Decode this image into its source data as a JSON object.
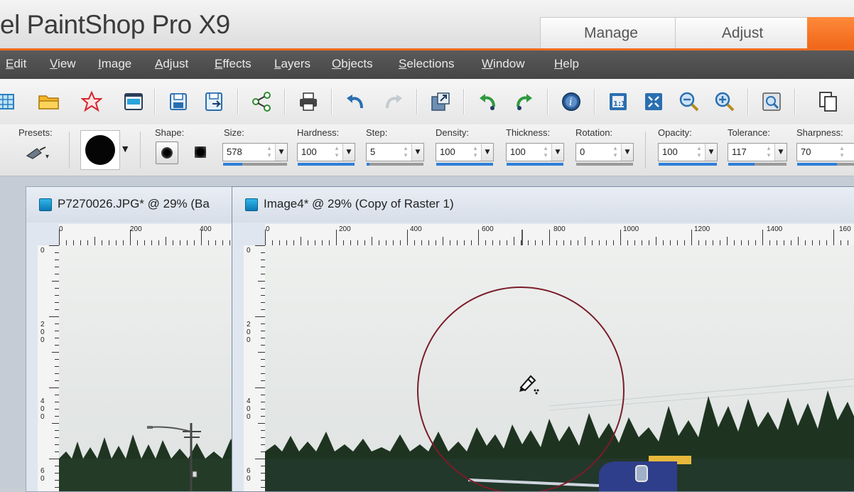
{
  "window": {
    "title": "el PaintShop Pro X9",
    "workspace_tabs": [
      {
        "label": "Manage"
      },
      {
        "label": "Adjust"
      }
    ],
    "accent_color": "#ef6c1f"
  },
  "menu": {
    "items": [
      {
        "label": "Edit"
      },
      {
        "label": "View"
      },
      {
        "label": "Image"
      },
      {
        "label": "Adjust"
      },
      {
        "label": "Effects"
      },
      {
        "label": "Layers"
      },
      {
        "label": "Objects"
      },
      {
        "label": "Selections"
      },
      {
        "label": "Window"
      },
      {
        "label": "Help"
      }
    ]
  },
  "toolbar": {
    "buttons": [
      {
        "icon": "grid-icon"
      },
      {
        "icon": "open-folder-icon"
      },
      {
        "icon": "star-icon"
      },
      {
        "icon": "scanner-icon"
      },
      {
        "icon": "save-icon"
      },
      {
        "icon": "save-as-icon"
      },
      {
        "icon": "share-icon"
      },
      {
        "icon": "print-icon"
      },
      {
        "icon": "undo-icon"
      },
      {
        "icon": "redo-icon"
      },
      {
        "icon": "resize-icon"
      },
      {
        "icon": "rotate-left-icon"
      },
      {
        "icon": "rotate-right-icon"
      },
      {
        "icon": "info-icon"
      },
      {
        "icon": "actual-size-icon"
      },
      {
        "icon": "fit-window-icon"
      },
      {
        "icon": "zoom-out-icon"
      },
      {
        "icon": "zoom-in-icon"
      },
      {
        "icon": "zoom-box-icon"
      },
      {
        "icon": "copy-icon"
      }
    ]
  },
  "tool_options": {
    "presets_label": "Presets:",
    "shape_label": "Shape:",
    "fields": [
      {
        "label": "Size:",
        "value": "578",
        "fill": 0.3
      },
      {
        "label": "Hardness:",
        "value": "100",
        "fill": 1.0
      },
      {
        "label": "Step:",
        "value": "5",
        "fill": 0.05
      },
      {
        "label": "Density:",
        "value": "100",
        "fill": 1.0
      },
      {
        "label": "Thickness:",
        "value": "100",
        "fill": 1.0
      },
      {
        "label": "Rotation:",
        "value": "0",
        "fill": 0.0
      },
      {
        "label": "Opacity:",
        "value": "100",
        "fill": 1.0
      },
      {
        "label": "Tolerance:",
        "value": "117",
        "fill": 0.45
      },
      {
        "label": "Sharpness:",
        "value": "70",
        "fill": 0.7
      }
    ]
  },
  "documents": [
    {
      "title": "P7270026.JPG* @  29% (Ba",
      "hruler_labels": [
        "0",
        "200",
        "400"
      ],
      "vruler_labels": [
        "0",
        "2 0 0",
        "4 0 0",
        "6 0"
      ]
    },
    {
      "title": "Image4* @  29% (Copy of Raster 1)",
      "hruler_labels": [
        "0",
        "200",
        "400",
        "600",
        "800",
        "1000",
        "1200",
        "1400",
        "160"
      ],
      "vruler_labels": [
        "0",
        "2 0 0",
        "4 0 0",
        "6 0"
      ]
    }
  ]
}
